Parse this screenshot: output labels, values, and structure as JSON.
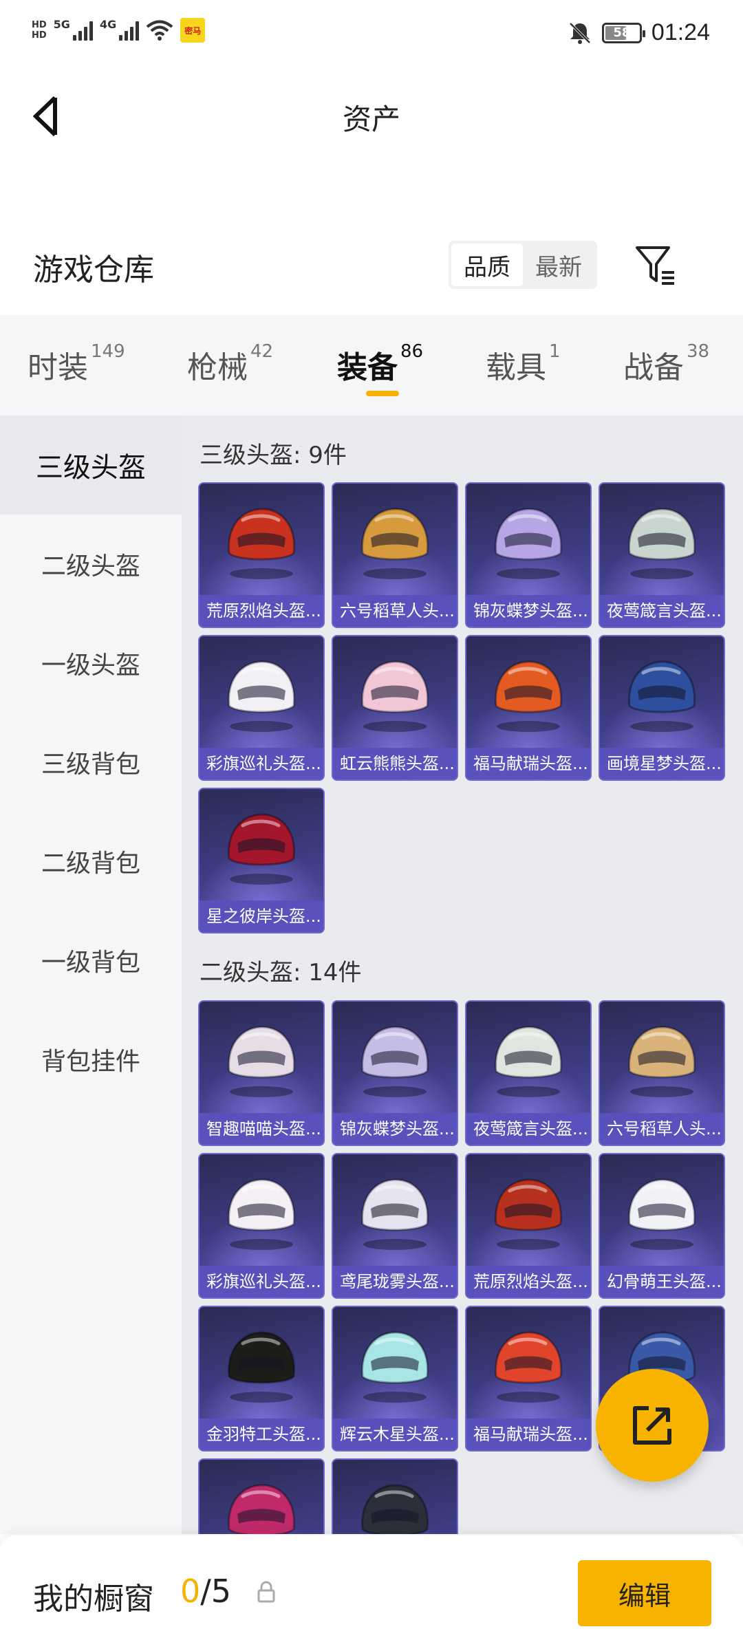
{
  "status_bar": {
    "hd1": "HD",
    "hd2": "HD",
    "network1": "5G",
    "network2": "4G",
    "app_badge": "密马",
    "battery": "58",
    "time": "01:24"
  },
  "header": {
    "title": "资产"
  },
  "library": {
    "title": "游戏仓库",
    "sort_options": [
      "品质",
      "最新"
    ],
    "active_sort": "品质"
  },
  "tabs": [
    {
      "label": "时装",
      "count": "149"
    },
    {
      "label": "枪械",
      "count": "42"
    },
    {
      "label": "装备",
      "count": "86"
    },
    {
      "label": "载具",
      "count": "1"
    },
    {
      "label": "战备",
      "count": "38"
    }
  ],
  "active_tab": "装备",
  "sidebar": {
    "items": [
      "三级头盔",
      "二级头盔",
      "一级头盔",
      "三级背包",
      "二级背包",
      "一级背包",
      "背包挂件"
    ],
    "active": "三级头盔"
  },
  "groups": [
    {
      "title": "三级头盔: 9件",
      "items": [
        {
          "label": "荒原烈焰头盔...",
          "color": "#c8321e"
        },
        {
          "label": "六号稻草人头...",
          "color": "#d79a3c"
        },
        {
          "label": "锦灰蝶梦头盔...",
          "color": "#b7a6e6"
        },
        {
          "label": "夜莺箴言头盔...",
          "color": "#c9d6cf"
        },
        {
          "label": "彩旗巡礼头盔...",
          "color": "#f2f0f5"
        },
        {
          "label": "虹云熊熊头盔...",
          "color": "#f1c7d8"
        },
        {
          "label": "福马献瑞头盔...",
          "color": "#e35a22"
        },
        {
          "label": "画境星梦头盔...",
          "color": "#2d4f9e"
        },
        {
          "label": "星之彼岸头盔...",
          "color": "#a3162c"
        }
      ]
    },
    {
      "title": "二级头盔: 14件",
      "items": [
        {
          "label": "智趣喵喵头盔...",
          "color": "#e7dde6"
        },
        {
          "label": "锦灰蝶梦头盔...",
          "color": "#c6bde6"
        },
        {
          "label": "夜莺箴言头盔...",
          "color": "#dfe6df"
        },
        {
          "label": "六号稻草人头...",
          "color": "#d9b37a"
        },
        {
          "label": "彩旗巡礼头盔...",
          "color": "#f4f0f6"
        },
        {
          "label": "鸢尾珑雾头盔...",
          "color": "#e5e3ef"
        },
        {
          "label": "荒原烈焰头盔...",
          "color": "#b8311f"
        },
        {
          "label": "幻骨萌王头盔...",
          "color": "#f1f1f8"
        },
        {
          "label": "金羽特工头盔...",
          "color": "#1d1d1a"
        },
        {
          "label": "辉云木星头盔...",
          "color": "#a8e6e6"
        },
        {
          "label": "福马献瑞头盔...",
          "color": "#e0452c"
        },
        {
          "label": "",
          "color": "#3a5aa8"
        },
        {
          "label": "",
          "color": "#c02a6a"
        },
        {
          "label": "",
          "color": "#2a2f3a"
        }
      ]
    }
  ],
  "bottom_bar": {
    "title": "我的橱窗",
    "current": "0",
    "separator_total": "/5",
    "edit_label": "编辑"
  }
}
